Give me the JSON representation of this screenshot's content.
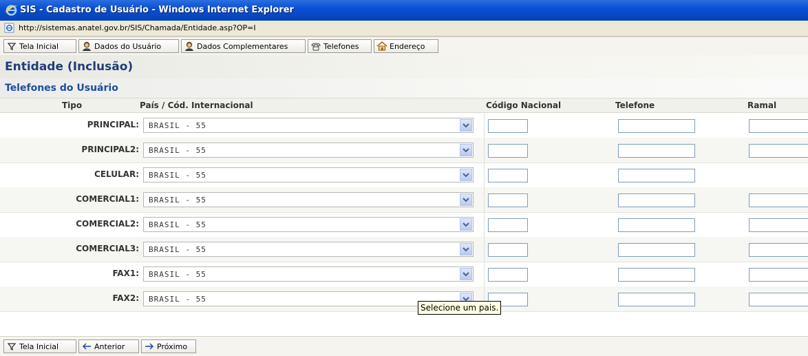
{
  "window": {
    "title": "SIS - Cadastro de Usuário - Windows Internet Explorer"
  },
  "address": {
    "url": "http://sistemas.anatel.gov.br/SIS/Chamada/Entidade.asp?OP=I"
  },
  "toolbar_top": {
    "tela_inicial": "Tela Inicial",
    "dados_usuario": "Dados do Usuário",
    "dados_complementares": "Dados Complementares",
    "telefones": "Telefones",
    "endereco": "Endereço"
  },
  "page": {
    "title": "Entidade (Inclusão)",
    "subtitle": "Telefones do Usuário"
  },
  "columns": {
    "tipo": "Tipo",
    "pais": "País / Cód. Internacional",
    "codigo_nacional": "Código Nacional",
    "telefone": "Telefone",
    "ramal": "Ramal"
  },
  "rows": [
    {
      "tipo": "PRINCIPAL:",
      "pais": "BRASIL - 55",
      "has_ramal": true
    },
    {
      "tipo": "PRINCIPAL2:",
      "pais": "BRASIL - 55",
      "has_ramal": true
    },
    {
      "tipo": "CELULAR:",
      "pais": "BRASIL - 55",
      "has_ramal": false
    },
    {
      "tipo": "COMERCIAL1:",
      "pais": "BRASIL - 55",
      "has_ramal": true
    },
    {
      "tipo": "COMERCIAL2:",
      "pais": "BRASIL - 55",
      "has_ramal": true
    },
    {
      "tipo": "COMERCIAL3:",
      "pais": "BRASIL - 55",
      "has_ramal": true
    },
    {
      "tipo": "FAX1:",
      "pais": "BRASIL - 55",
      "has_ramal": true
    },
    {
      "tipo": "FAX2:",
      "pais": "BRASIL - 55",
      "has_ramal": true
    }
  ],
  "tooltip": "Selecione um pais.",
  "toolbar_bottom": {
    "tela_inicial": "Tela Inicial",
    "anterior": "Anterior",
    "proximo": "Próximo"
  },
  "colors": {
    "title_blue": "#1d3e7a",
    "subtitle_blue": "#1d4e9a",
    "titlebar": "#0a4fd4"
  },
  "icons": [
    "ie-logo-icon",
    "page-icon",
    "filter-icon",
    "user-icon",
    "phone-icon",
    "home-icon",
    "arrow-left-icon",
    "arrow-right-icon",
    "dropdown-arrow-icon"
  ]
}
